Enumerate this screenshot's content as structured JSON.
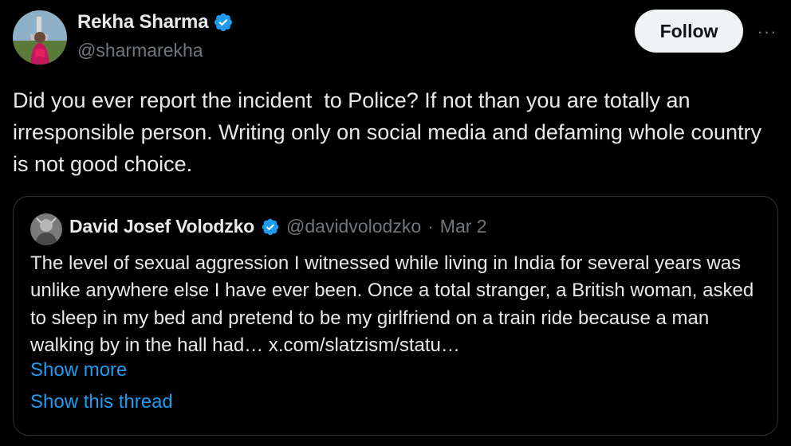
{
  "author": {
    "display_name": "Rekha Sharma",
    "handle": "@sharmarekha",
    "verified": true
  },
  "actions": {
    "follow_label": "Follow",
    "more_label": "···"
  },
  "tweet": {
    "text": "Did you ever report the incident  to Police? If not than you are totally an irresponsible person. Writing only on social media and defaming whole country is not good choice."
  },
  "quoted_tweet": {
    "display_name": "David Josef Volodzko",
    "handle": "@davidvolodzko",
    "separator": "·",
    "date": "Mar 2",
    "text": "The level of sexual aggression I witnessed while living in India for several years was unlike anywhere else I have ever been. Once a total stranger, a British woman, asked to sleep in my bed and pretend to be my girlfriend on a train ride because a man walking by in the hall had…",
    "link": "x.com/slatzism/statu…",
    "show_more_label": "Show more",
    "show_thread_label": "Show this thread"
  },
  "colors": {
    "background": "#000000",
    "text_primary": "#e7e9ea",
    "text_secondary": "#71767b",
    "accent": "#1d9bf0",
    "border": "#2f3336",
    "follow_bg": "#eff3f4"
  }
}
